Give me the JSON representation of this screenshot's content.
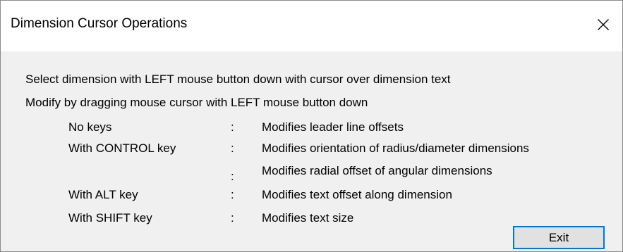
{
  "window": {
    "title": "Dimension Cursor Operations",
    "close_icon": "close-x-icon"
  },
  "instructions": {
    "line1": "Select dimension with LEFT mouse button down with cursor over dimension text",
    "line2": "Modify by dragging mouse cursor with LEFT mouse button down"
  },
  "operations": [
    {
      "key": "No keys",
      "separator": ":",
      "description": "Modifies leader line offsets"
    },
    {
      "key": "With CONTROL key",
      "separator": ":",
      "description": "Modifies orientation of radius/diameter dimensions"
    },
    {
      "key": "",
      "separator": ":",
      "description": "Modifies radial offset of angular dimensions"
    },
    {
      "key": "With ALT key",
      "separator": ":",
      "description": "Modifies text offset along dimension"
    },
    {
      "key": "With SHIFT key",
      "separator": ":",
      "description": "Modifies text size"
    }
  ],
  "buttons": {
    "exit_label": "Exit"
  },
  "colors": {
    "client_background": "#f0f0f0",
    "button_focus_border": "#0078d7"
  }
}
